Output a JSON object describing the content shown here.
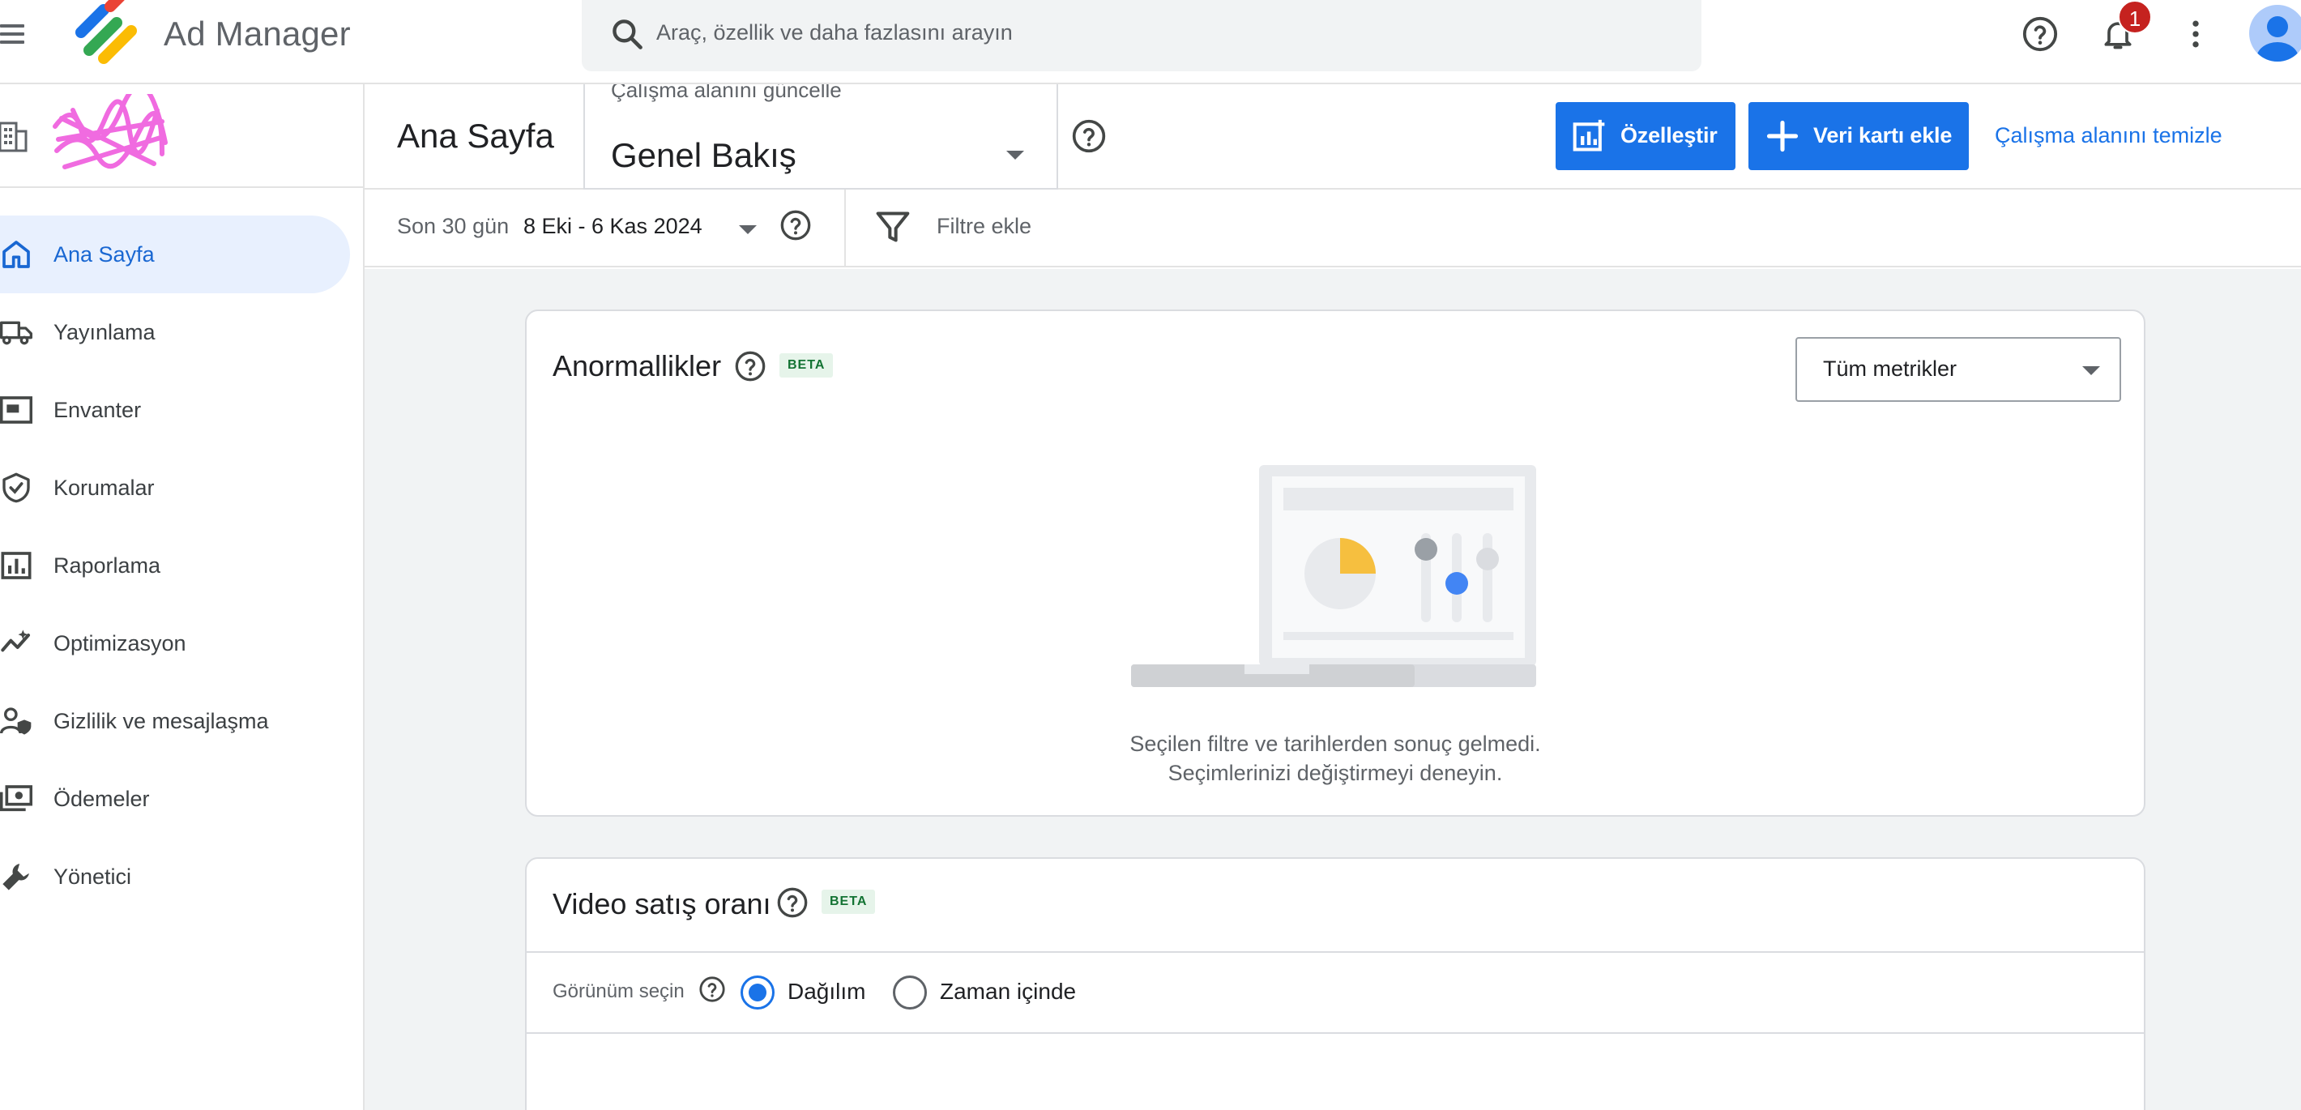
{
  "app": {
    "title": "Ad Manager",
    "notifications_count": "1"
  },
  "search": {
    "placeholder": "Araç, özellik ve daha fazlasını arayın"
  },
  "sidebar": {
    "items": [
      {
        "label": "Ana Sayfa",
        "icon": "home-icon",
        "active": true
      },
      {
        "label": "Yayınlama",
        "icon": "truck-icon"
      },
      {
        "label": "Envanter",
        "icon": "inventory-icon"
      },
      {
        "label": "Korumalar",
        "icon": "shield-check-icon"
      },
      {
        "label": "Raporlama",
        "icon": "bar-chart-icon"
      },
      {
        "label": "Optimizasyon",
        "icon": "optimization-icon"
      },
      {
        "label": "Gizlilik ve mesajlaşma",
        "icon": "privacy-icon"
      },
      {
        "label": "Ödemeler",
        "icon": "payments-icon"
      },
      {
        "label": "Yönetici",
        "icon": "wrench-icon"
      }
    ]
  },
  "header": {
    "page_title": "Ana Sayfa",
    "workspace_caption": "Çalışma alanını güncelle",
    "workspace_value": "Genel Bakış",
    "customize_label": "Özelleştir",
    "add_card_label": "Veri kartı ekle",
    "clear_label": "Çalışma alanını temizle"
  },
  "filters": {
    "date_label": "Son 30 gün",
    "date_value": "8 Eki - 6 Kas 2024",
    "add_filter_label": "Filtre ekle"
  },
  "anomalies_card": {
    "title": "Anormallikler",
    "badge": "BETA",
    "metric_select_value": "Tüm metrikler",
    "empty_line1": "Seçilen filtre ve tarihlerden sonuç gelmedi.",
    "empty_line2": "Seçimlerinizi değiştirmeyi deneyin."
  },
  "video_card": {
    "title": "Video satış oranı",
    "badge": "BETA",
    "view_label": "Görünüm seçin",
    "options": [
      {
        "label": "Dağılım",
        "selected": true
      },
      {
        "label": "Zaman içinde",
        "selected": false
      }
    ]
  },
  "colors": {
    "primary": "#1a73e8",
    "active_nav_bg": "#e8f0fe",
    "badge_red": "#c5221f",
    "beta_bg": "#e6f4ea",
    "beta_text": "#137333",
    "main_bg": "#f1f3f4"
  }
}
